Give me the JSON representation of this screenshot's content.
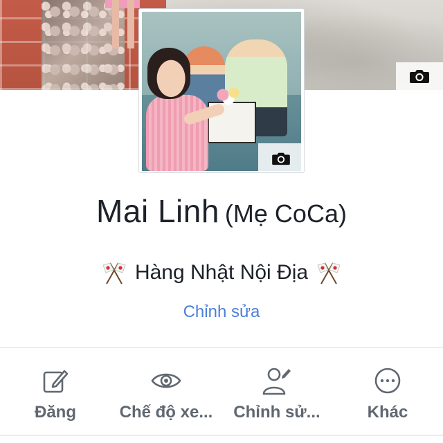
{
  "profile": {
    "name": "Mai Linh",
    "alternate_name": "(Mẹ CoCa)",
    "bio": "Hàng Nhật Nội Địa",
    "edit_bio_link": "Chỉnh sửa"
  },
  "icons": {
    "cover_camera": "camera-icon",
    "avatar_camera": "camera-icon",
    "bio_flags": "crossed-flags-emoji"
  },
  "actions": [
    {
      "label": "Đăng",
      "icon": "pencil-square-icon"
    },
    {
      "label": "Chế độ xe...",
      "icon": "eye-icon"
    },
    {
      "label": "Chỉnh sử...",
      "icon": "edit-person-icon"
    },
    {
      "label": "Khác",
      "icon": "more-dots-icon"
    }
  ],
  "colors": {
    "link": "#4a80d6",
    "action_gray": "#606770",
    "text": "#1d2129"
  }
}
